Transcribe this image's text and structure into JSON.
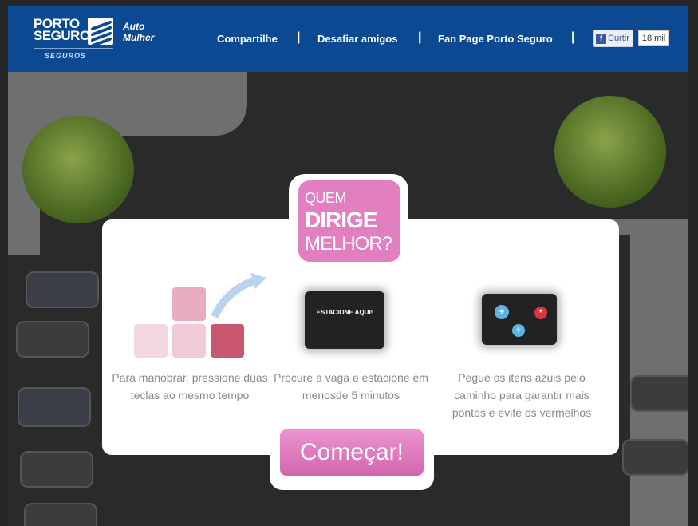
{
  "header": {
    "brand_line1": "PORTO",
    "brand_line2": "SEGURO",
    "brand_sub": "SEGUROS",
    "product_line1": "Auto",
    "product_line2": "Mulher",
    "nav": [
      "Compartilhe",
      "Desafiar amigos",
      "Fan Page Porto Seguro"
    ],
    "like_label": "Curtir",
    "like_count": "18 mil"
  },
  "badge": {
    "line1": "QUEM",
    "line2": "DIRIGE",
    "line3": "MELHOR?"
  },
  "steps": [
    {
      "icon": "arrow-keys-icon",
      "text": "Para manobrar, pressione duas teclas ao mesmo tempo"
    },
    {
      "icon": "parking-sign-icon",
      "sign_label": "ESTACIONE AQUI!",
      "text": "Procure a vaga e estacione em menosde 5 minutos"
    },
    {
      "icon": "items-icon",
      "text": "Pegue os itens azuis pelo caminho para garantir mais pontos e evite os vermelhos"
    }
  ],
  "start_button": "Começar!",
  "colors": {
    "header_bg": "#0b4a93",
    "accent_pink": "#e27fc0",
    "text_gray": "#8a8a8a"
  }
}
